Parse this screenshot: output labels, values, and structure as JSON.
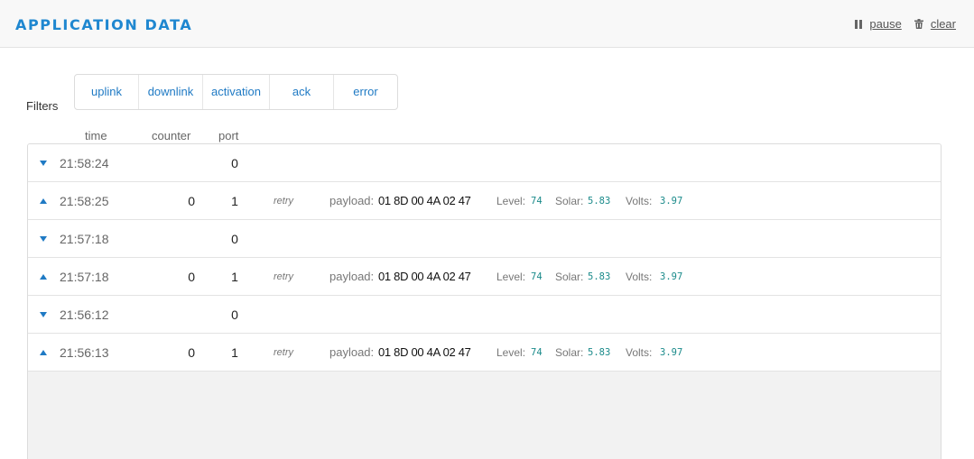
{
  "header": {
    "title": "APPLICATION DATA",
    "pause_label": "pause",
    "clear_label": "clear"
  },
  "filters": {
    "label": "Filters",
    "items": [
      "uplink",
      "downlink",
      "activation",
      "ack",
      "error"
    ]
  },
  "columns": {
    "time": "time",
    "counter": "counter",
    "port": "port"
  },
  "rows": [
    {
      "direction": "down",
      "time": "21:58:24",
      "counter": "",
      "port": "0"
    },
    {
      "direction": "up",
      "time": "21:58:25",
      "counter": "0",
      "port": "1",
      "retry": "retry",
      "payload_label": "payload:",
      "payload": "01 8D 00 4A 02 47",
      "level_label": "Level:",
      "level": "74",
      "solar_label": "Solar:",
      "solar": "5.83",
      "volts_label": "Volts:",
      "volts": "3.97"
    },
    {
      "direction": "down",
      "time": "21:57:18",
      "counter": "",
      "port": "0"
    },
    {
      "direction": "up",
      "time": "21:57:18",
      "counter": "0",
      "port": "1",
      "retry": "retry",
      "payload_label": "payload:",
      "payload": "01 8D 00 4A 02 47",
      "level_label": "Level:",
      "level": "74",
      "solar_label": "Solar:",
      "solar": "5.83",
      "volts_label": "Volts:",
      "volts": "3.97"
    },
    {
      "direction": "down",
      "time": "21:56:12",
      "counter": "",
      "port": "0"
    },
    {
      "direction": "up",
      "time": "21:56:13",
      "counter": "0",
      "port": "1",
      "retry": "retry",
      "payload_label": "payload:",
      "payload": "01 8D 00 4A 02 47",
      "level_label": "Level:",
      "level": "74",
      "solar_label": "Solar:",
      "solar": "5.83",
      "volts_label": "Volts:",
      "volts": "3.97"
    }
  ],
  "colors": {
    "accent": "#1f87d0",
    "link": "#1f7ac4",
    "field_value": "#1a8a8a"
  },
  "icons": {
    "pause": "pause-icon",
    "clear": "trash-icon",
    "expand": "caret-down-icon",
    "collapse": "caret-up-icon"
  }
}
